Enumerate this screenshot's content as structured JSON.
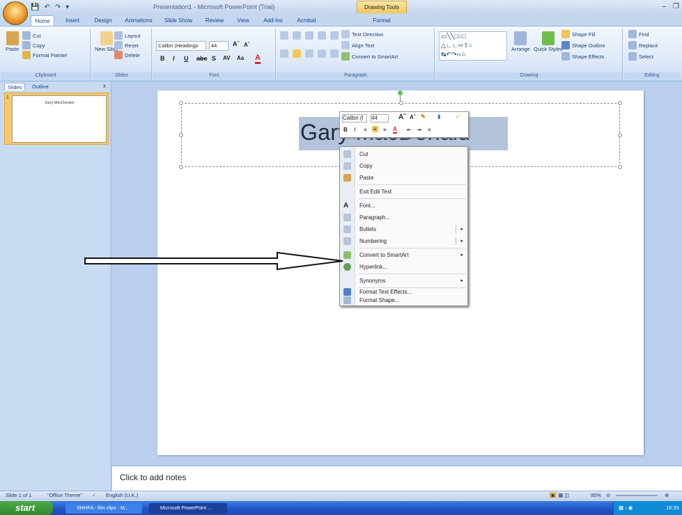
{
  "app": {
    "office_button_label": "",
    "title": "Presentation1 - Microsoft PowerPoint (Trial)",
    "contextual_tab": "Drawing Tools"
  },
  "tabs": [
    "Home",
    "Insert",
    "Design",
    "Animations",
    "Slide Show",
    "Review",
    "View",
    "Add-Ins",
    "Acrobat",
    "Format"
  ],
  "ribbon": {
    "clipboard": {
      "label": "Clipboard",
      "paste": "Paste",
      "cut": "Cut",
      "copy": "Copy",
      "format_painter": "Format Painter"
    },
    "slides": {
      "label": "Slides",
      "new_slide": "New Slide",
      "layout": "Layout",
      "reset": "Reset",
      "delete": "Delete"
    },
    "font": {
      "label": "Font",
      "font_name": "Calibri (Headings",
      "font_size": "44"
    },
    "paragraph": {
      "label": "Paragraph",
      "text_direction": "Text Direction",
      "align_text": "Align Text",
      "convert_smartart": "Convert to SmartArt"
    },
    "drawing": {
      "label": "Drawing",
      "arrange": "Arrange",
      "quick_styles": "Quick Styles",
      "shape_fill": "Shape Fill",
      "shape_outline": "Shape Outline",
      "shape_effects": "Shape Effects"
    },
    "editing": {
      "label": "Editing",
      "find": "Find",
      "replace": "Replace",
      "select": "Select"
    }
  },
  "pane": {
    "tab_slides": "Slides",
    "tab_outline": "Outline",
    "close": "x",
    "slide_number": "1",
    "thumb_title": "Gary MacDonald"
  },
  "slide": {
    "title": "Gary MacDonald"
  },
  "mini_toolbar": {
    "font": "Calibri (I",
    "size": "44"
  },
  "context_menu": {
    "items": [
      "Cut",
      "Copy",
      "Paste",
      "Exit Edit Text",
      "Font...",
      "Paragraph...",
      "Bullets",
      "Numbering",
      "Convert to SmartArt",
      "Hyperlink...",
      "Synonyms",
      "Format Text Effects...",
      "Format Shape..."
    ]
  },
  "notes": {
    "placeholder": "Click to add notes"
  },
  "status": {
    "slide": "Slide 1 of 1",
    "theme": "\"Office Theme\"",
    "language": "English (U.K.)",
    "zoom": "95%"
  },
  "taskbar": {
    "start": "start",
    "task1": "SMHFA - film clips - M...",
    "task2": "Microsoft PowerPoint ...",
    "clock": "16:35"
  },
  "colors": {
    "ribbon": "#dce8f8",
    "taskbar": "#2456c7",
    "start": "#2f8a2b",
    "selection": "#b3c3d9"
  }
}
